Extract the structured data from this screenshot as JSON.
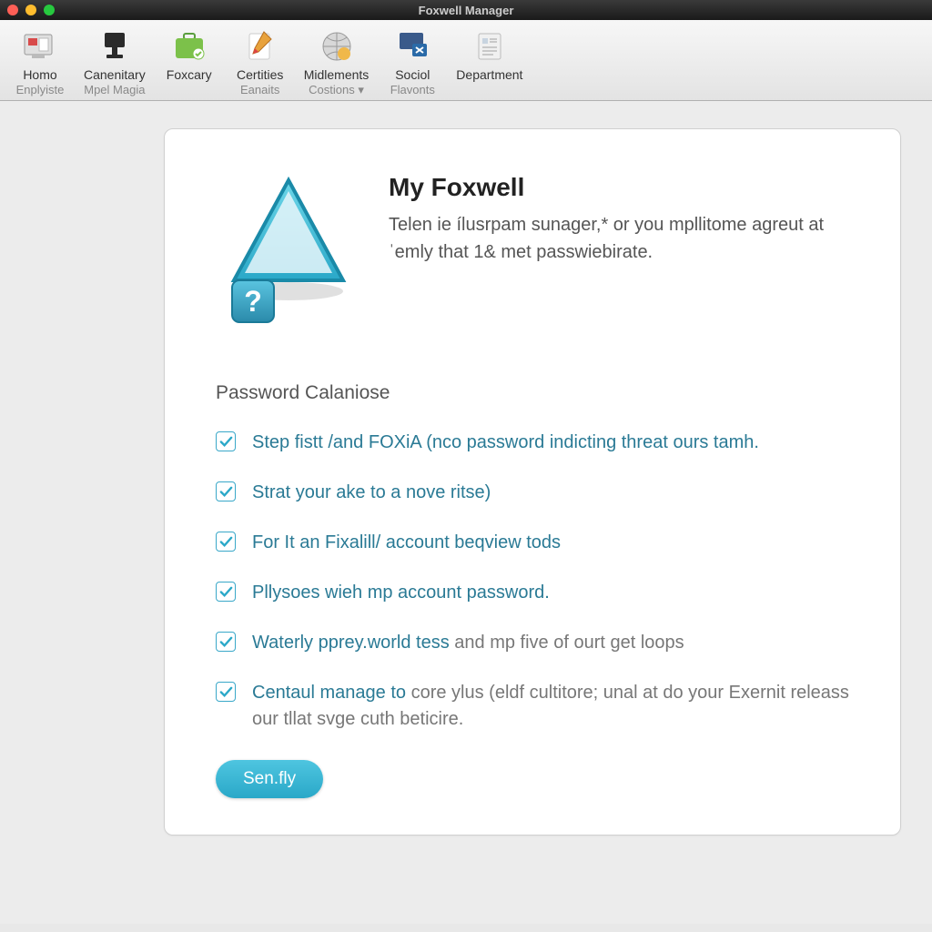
{
  "window": {
    "title": "Foxwell Manager"
  },
  "toolbar": {
    "items": [
      {
        "label": "Homo",
        "sublabel": "Enplyiste"
      },
      {
        "label": "Canenitary",
        "sublabel": "Mpel Magia"
      },
      {
        "label": "Foxcary",
        "sublabel": ""
      },
      {
        "label": "Certities",
        "sublabel": "Eanaits"
      },
      {
        "label": "Midlements",
        "sublabel": "Costions ▾"
      },
      {
        "label": "Sociol",
        "sublabel": "Flavonts"
      },
      {
        "label": "Department",
        "sublabel": ""
      }
    ]
  },
  "hero": {
    "title": "My Foxwell",
    "subtitle": "Telen ie ílusrpam sunager,* or you mpllitome agreut atˈemly that 1& met passwiebirate."
  },
  "section": {
    "title": "Password Calaniose"
  },
  "checks": [
    {
      "text_a": "Step fistt /and FOXiA (nco password indicting threat ours tamh.",
      "text_b": ""
    },
    {
      "text_a": "Strat your ake to a nove ritse)",
      "text_b": ""
    },
    {
      "text_a": "For It an Fixalill/ account beqview tods",
      "text_b": ""
    },
    {
      "text_a": "Pllysoes wieh mp account password.",
      "text_b": ""
    },
    {
      "text_a": "Waterly pprey.world tess",
      "text_b": " and mp five of ourt get loops"
    },
    {
      "text_a": "Centaul manage to",
      "text_b": " core ylus (eldf cultitore; unal at do your Exernit releass our tllat svge cuth beticire."
    }
  ],
  "button": {
    "label": "Sen.fly"
  },
  "colors": {
    "accent": "#2aa8c8",
    "link": "#2a7a95"
  }
}
